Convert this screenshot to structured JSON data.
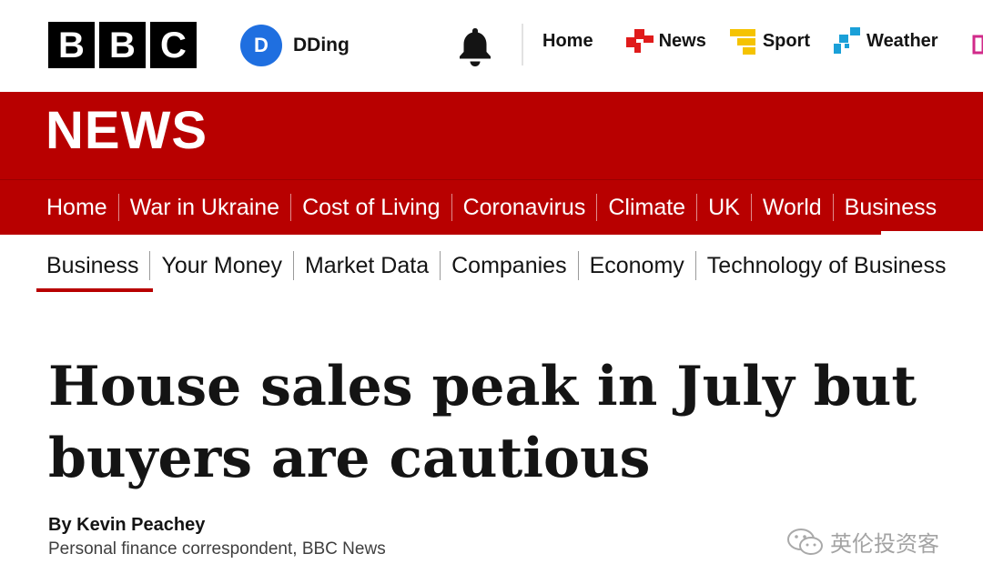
{
  "logo": {
    "letters": [
      "B",
      "B",
      "C"
    ]
  },
  "account": {
    "initial": "D",
    "name": "DDing"
  },
  "top_nav": [
    {
      "label": "Home",
      "icon": null
    },
    {
      "label": "News",
      "icon": "news-icon"
    },
    {
      "label": "Sport",
      "icon": "sport-icon"
    },
    {
      "label": "Weather",
      "icon": "weather-icon"
    }
  ],
  "banner": {
    "title": "NEWS"
  },
  "section_nav": [
    "Home",
    "War in Ukraine",
    "Cost of Living",
    "Coronavirus",
    "Climate",
    "UK",
    "World",
    "Business"
  ],
  "sub_nav": [
    "Business",
    "Your Money",
    "Market Data",
    "Companies",
    "Economy",
    "Technology of Business"
  ],
  "article": {
    "headline_line1": "House sales peak in July but",
    "headline_line2": "buyers are cautious",
    "author": "By Kevin Peachey",
    "author_role": "Personal finance correspondent, BBC News"
  },
  "watermark": {
    "text": "英伦投资客"
  },
  "colors": {
    "brand_red": "#b80000",
    "avatar_blue": "#1f6fe0",
    "news_icon": "#e01b1b",
    "sport_icon": "#f5c300",
    "weather_icon": "#1aa0d8"
  }
}
